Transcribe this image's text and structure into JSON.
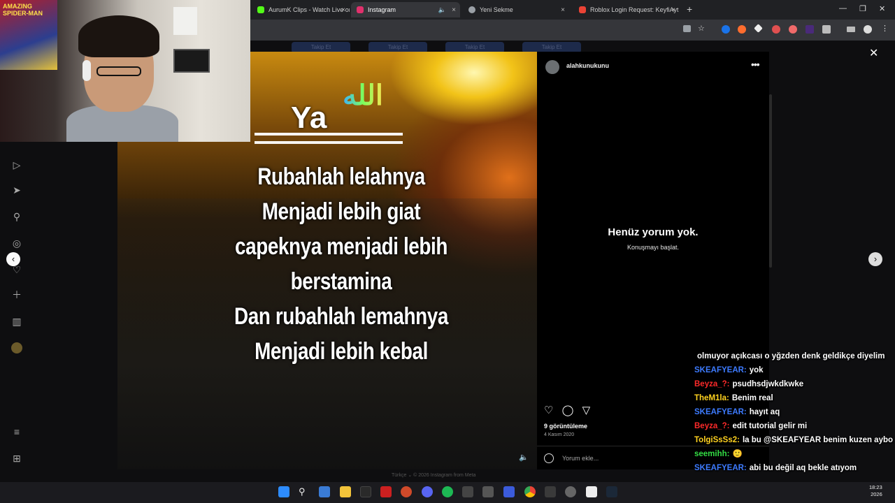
{
  "browser": {
    "tabs": [
      {
        "label": "AurumK Clips - Watch Live on Kick",
        "color": "#53fc18"
      },
      {
        "label": "Instagram",
        "color": "#e1306c"
      },
      {
        "label": "Yeni Sekme",
        "color": "#9aa0a6"
      },
      {
        "label": "Roblox Login Request: KeyfiAyt",
        "color": "#ea4335"
      }
    ],
    "new_tab": "+",
    "close_glyph": "×"
  },
  "webcam": {
    "poster_text": "AMAZING SPIDER-MAN"
  },
  "background_page": {
    "follow_buttons": [
      "Takip Et",
      "Takip Et",
      "Takip Et",
      "Takip Et"
    ]
  },
  "video": {
    "ya": "Ya",
    "allah": "الله",
    "lines": [
      "Rubahlah lelahnya",
      "Menjadi lebih giat",
      "capeknya menjadi lebih",
      "berstamina",
      "Dan rubahlah lemahnya",
      "Menjadi lebih kebal"
    ]
  },
  "post": {
    "username": "alahkunukunu",
    "more": "•••",
    "empty_title": "Henüz yorum yok.",
    "empty_subtitle": "Konuşmayı başlat.",
    "views": "9 görüntüleme",
    "date": "4 Kasım 2020",
    "comment_placeholder": "Yorum ekle..."
  },
  "footer": {
    "text": "Türkçe ⌄    © 2026 Instagram from Meta"
  },
  "chat": {
    "lines": [
      {
        "user": "",
        "color": "#ffffff",
        "text": "olmuyor açıkcası o yğzden denk geldikçe diyelim"
      },
      {
        "user": "SKEAFYEAR:",
        "color": "#3d7bff",
        "text": "yok"
      },
      {
        "user": "Beyza_?:",
        "color": "#ff2a2a",
        "text": "psudhsdjwkdkwke"
      },
      {
        "user": "TheM1la:",
        "color": "#ffd21f",
        "text": "Benim real"
      },
      {
        "user": "SKEAFYEAR:",
        "color": "#3d7bff",
        "text": "hayıt aq"
      },
      {
        "user": "Beyza_?:",
        "color": "#ff2a2a",
        "text": "edit tutorial gelir mi"
      },
      {
        "user": "TolgiSsSs2:",
        "color": "#ffd21f",
        "text": "la bu @SKEAFYEAR benim kuzen aybo"
      },
      {
        "user": "seemihh:",
        "color": "#33dd44",
        "text": "🙂"
      },
      {
        "user": "SKEAFYEAR:",
        "color": "#3d7bff",
        "text": "abi bu değil aq bekle atıyom"
      }
    ]
  },
  "taskbar": {
    "time": "18:23",
    "date": "2026"
  }
}
